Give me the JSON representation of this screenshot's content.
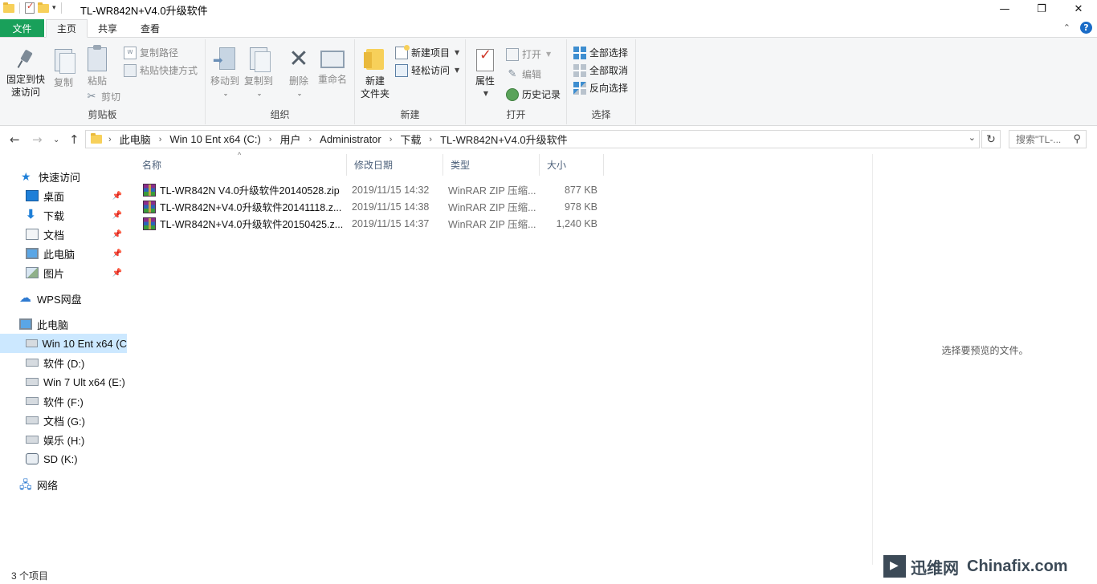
{
  "window": {
    "title": "TL-WR842N+V4.0升级软件",
    "controls": {
      "minimize": "—",
      "maximize": "❐",
      "close": "✕"
    }
  },
  "tabs": {
    "file": "文件",
    "items": [
      "主页",
      "共享",
      "查看"
    ],
    "active": "主页"
  },
  "ribbon": {
    "clipboard": {
      "label": "剪贴板",
      "pin": "固定到快\n速访问",
      "pin_l1": "固定到快",
      "pin_l2": "速访问",
      "copy": "复制",
      "paste": "粘贴",
      "copy_path": "复制路径",
      "paste_shortcut": "粘贴快捷方式",
      "cut": "剪切"
    },
    "organize": {
      "label": "组织",
      "move_to": "移动到",
      "copy_to": "复制到",
      "delete": "删除",
      "rename": "重命名"
    },
    "new": {
      "label": "新建",
      "new_folder_l1": "新建",
      "new_folder_l2": "文件夹",
      "new_item": "新建项目",
      "easy_access": "轻松访问"
    },
    "open": {
      "label": "打开",
      "properties": "属性",
      "open": "打开",
      "edit": "编辑",
      "history": "历史记录"
    },
    "select": {
      "label": "选择",
      "select_all": "全部选择",
      "select_none": "全部取消",
      "invert": "反向选择"
    }
  },
  "address": {
    "crumbs": [
      "此电脑",
      "Win 10 Ent x64 (C:)",
      "用户",
      "Administrator",
      "下载",
      "TL-WR842N+V4.0升级软件"
    ],
    "search_placeholder": "搜索\"TL-..."
  },
  "nav": {
    "quick_access": "快速访问",
    "pinned": [
      {
        "label": "桌面",
        "icon": "desktop-icon"
      },
      {
        "label": "下载",
        "icon": "download-icon"
      },
      {
        "label": "文档",
        "icon": "documents-icon"
      },
      {
        "label": "此电脑",
        "icon": "this-pc-icon"
      },
      {
        "label": "图片",
        "icon": "pictures-icon"
      }
    ],
    "wps": "WPS网盘",
    "this_pc": "此电脑",
    "drives": [
      {
        "label": "Win 10 Ent x64 (C",
        "icon": "system-drive-icon",
        "selected": true
      },
      {
        "label": "软件 (D:)",
        "icon": "drive-icon"
      },
      {
        "label": "Win 7 Ult x64 (E:)",
        "icon": "drive-icon"
      },
      {
        "label": "软件 (F:)",
        "icon": "drive-icon"
      },
      {
        "label": "文档 (G:)",
        "icon": "drive-icon"
      },
      {
        "label": "娱乐 (H:)",
        "icon": "drive-icon"
      },
      {
        "label": "SD (K:)",
        "icon": "sd-card-icon"
      }
    ],
    "network": "网络"
  },
  "files": {
    "columns": [
      "名称",
      "修改日期",
      "类型",
      "大小"
    ],
    "rows": [
      {
        "name": "TL-WR842N V4.0升级软件20140528.zip",
        "date": "2019/11/15 14:32",
        "type": "WinRAR ZIP 压缩...",
        "size": "877 KB"
      },
      {
        "name": "TL-WR842N+V4.0升级软件20141118.z...",
        "date": "2019/11/15 14:38",
        "type": "WinRAR ZIP 压缩...",
        "size": "978 KB"
      },
      {
        "name": "TL-WR842N+V4.0升级软件20150425.z...",
        "date": "2019/11/15 14:37",
        "type": "WinRAR ZIP 压缩...",
        "size": "1,240 KB"
      }
    ]
  },
  "preview": {
    "empty_text": "选择要预览的文件。"
  },
  "status": {
    "item_count": "3 个项目"
  },
  "watermark": {
    "cn": "迅维网",
    "en": "Chinafix.com"
  },
  "colors": {
    "file_tab": "#19a05a",
    "selection": "#cce8ff",
    "accent": "#1e7fd8"
  }
}
